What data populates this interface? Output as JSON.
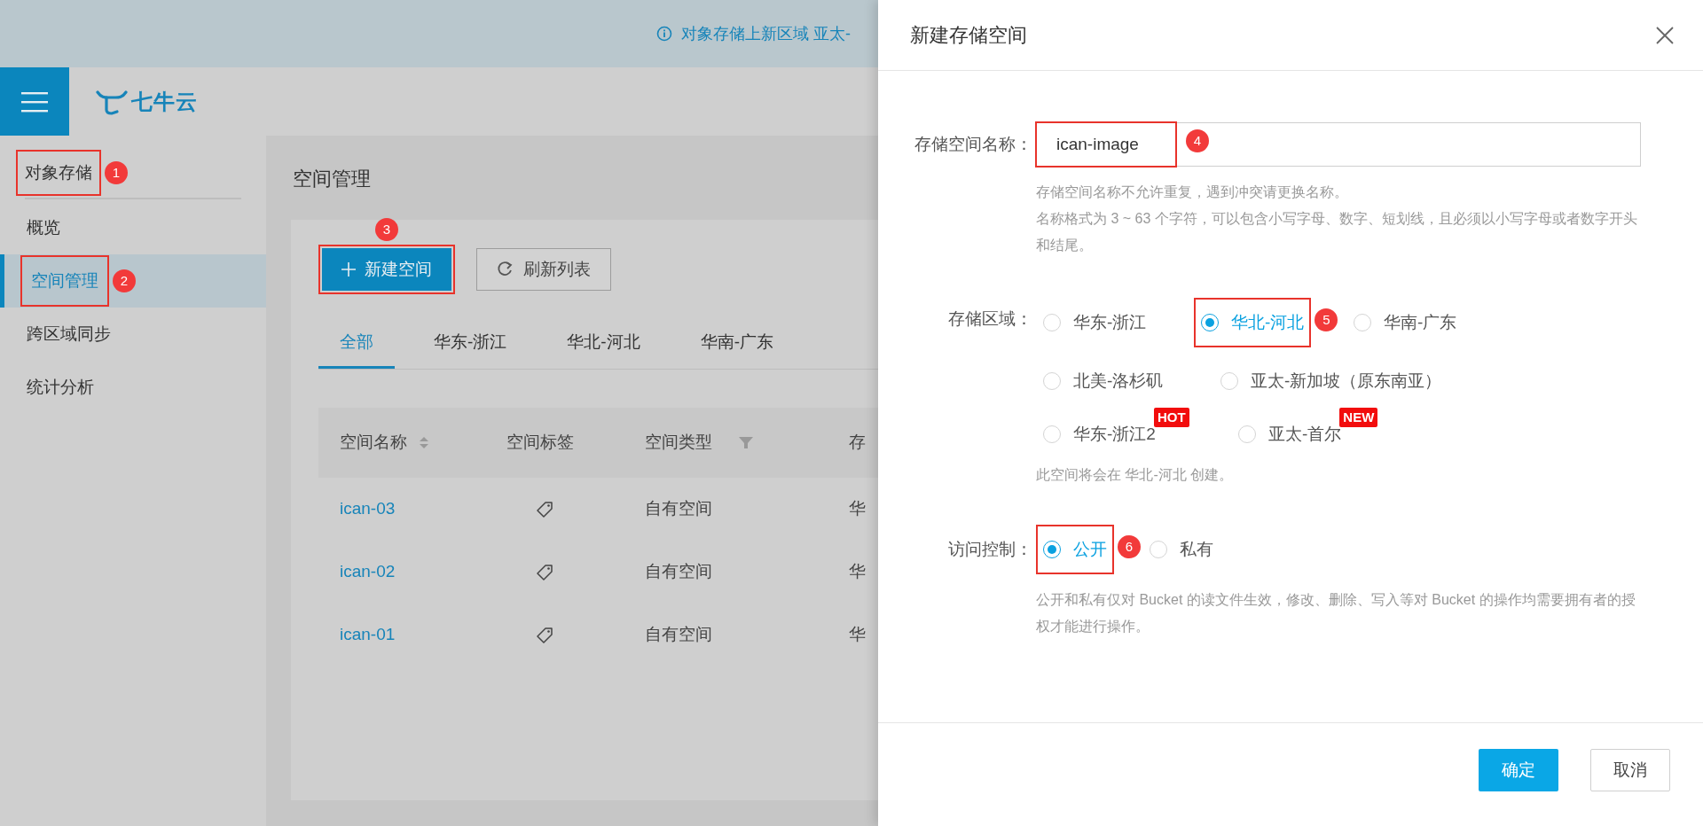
{
  "banner": {
    "text": "对象存储上新区域 亚太-"
  },
  "header": {
    "logo": "七牛云"
  },
  "sidebar": {
    "items": [
      {
        "label": "对象存储",
        "kind": "heading",
        "selected": false,
        "annotation": "1"
      },
      {
        "label": "概览",
        "kind": "item",
        "selected": false
      },
      {
        "label": "空间管理",
        "kind": "item",
        "selected": true,
        "annotation": "2"
      },
      {
        "label": "跨区域同步",
        "kind": "item",
        "selected": false
      },
      {
        "label": "统计分析",
        "kind": "item",
        "selected": false
      }
    ]
  },
  "page": {
    "title": "空间管理",
    "buttons": [
      {
        "label": "新建空间",
        "kind": "primary",
        "annotation": "3"
      },
      {
        "label": "刷新列表",
        "kind": "refresh"
      }
    ],
    "tabs": [
      {
        "label": "全部",
        "selected": true
      },
      {
        "label": "华东-浙江",
        "selected": false
      },
      {
        "label": "华北-河北",
        "selected": false
      },
      {
        "label": "华南-广东",
        "selected": false
      }
    ],
    "table": {
      "columns": [
        {
          "label": "空间名称",
          "kind": "sort"
        },
        {
          "label": "空间标签"
        },
        {
          "label": "空间类型",
          "kind": "filter"
        },
        {
          "label": "存"
        }
      ],
      "rows": [
        {
          "name": "ican-03",
          "type": "自有空间",
          "column_4": "华"
        },
        {
          "name": "ican-02",
          "type": "自有空间",
          "column_4": "华"
        },
        {
          "name": "ican-01",
          "type": "自有空间",
          "column_4": "华"
        }
      ]
    }
  },
  "dialog": {
    "title": "新建存储空间",
    "name_field": {
      "label": "存储空间名称：",
      "value": "ican-image",
      "annotation": "4",
      "hints": [
        "存储空间名称不允许重复，遇到冲突请更换名称。",
        "名称格式为 3 ~ 63 个字符，可以包含小写字母、数字、短划线，且必须以小写字母或者数字开头和结尾。"
      ]
    },
    "region": {
      "label": "存储区域：",
      "rows": [
        [
          {
            "label": "华东-浙江",
            "selected": false
          },
          {
            "label": "华北-河北",
            "selected": true,
            "annotation": "5"
          },
          {
            "label": "华南-广东",
            "selected": false
          }
        ],
        [
          {
            "label": "北美-洛杉矶",
            "selected": false
          },
          {
            "label": "亚太-新加坡（原东南亚）",
            "selected": false
          }
        ],
        [
          {
            "label": "华东-浙江2",
            "selected": false,
            "badge": "HOT"
          },
          {
            "label": "亚太-首尔",
            "selected": false,
            "badge": "NEW"
          }
        ]
      ],
      "hint": "此空间将会在 华北-河北 创建。"
    },
    "access": {
      "label": "访问控制：",
      "options": [
        {
          "label": "公开",
          "selected": true,
          "annotation": "6"
        },
        {
          "label": "私有",
          "selected": false
        }
      ],
      "hint": "公开和私有仅对 Bucket 的读文件生效，修改、删除、写入等对 Bucket 的操作均需要拥有者的授权才能进行操作。"
    },
    "buttons": [
      {
        "label": "确定",
        "kind": "primary"
      },
      {
        "label": "取消",
        "kind": "default"
      }
    ]
  }
}
